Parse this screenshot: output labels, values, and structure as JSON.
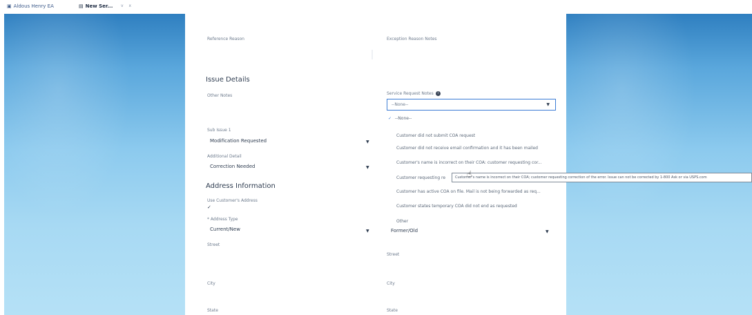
{
  "tabs": [
    {
      "icon": "person-card-icon",
      "label": "Aldous Henry EA"
    },
    {
      "icon": "briefcase-icon",
      "label": "New Ser..."
    }
  ],
  "tab_controls": "v x",
  "form": {
    "reference_reason_label": "Reference Reason",
    "exception_reason_notes_label": "Exception Reason Notes",
    "issue_details_heading": "Issue Details",
    "other_notes_label": "Other Notes",
    "service_request_notes_label": "Service Request Notes",
    "sub_issue_label": "Sub Issue 1",
    "sub_issue_value": "Modification Requested",
    "additional_detail_label": "Additional Detail",
    "additional_detail_value": "Correction Needed",
    "address_heading": "Address Information",
    "use_customer_address_label": "Use Customer's Address",
    "use_customer_address_check": "✓",
    "address_type_label": "* Address Type",
    "address_type_value": "Current/New",
    "address_type_value_right": "Former/Old",
    "street_label": "Street",
    "street_label_right": "Street",
    "city_label": "City",
    "city_label_right": "City",
    "state_label": "State",
    "state_label_right": "State"
  },
  "dropdown": {
    "selected": "--None--",
    "check": "✓",
    "options": [
      "--None--",
      "Customer did not submit COA request",
      "Customer did not receive email confirmation and it has been mailed",
      "Customer's name is incorrect on their COA: customer requesting cor...",
      "Customer requesting re",
      "Customer has active COA on file. Mail is not being forwarded as req...",
      "Customer states temporary COA did not end as requested",
      "Other"
    ]
  },
  "tooltip": "Customer's name is incorrect on their COA; customer requesting correction of the error. Issue can not be corrected by 1-800 Ask or via USPS.com"
}
